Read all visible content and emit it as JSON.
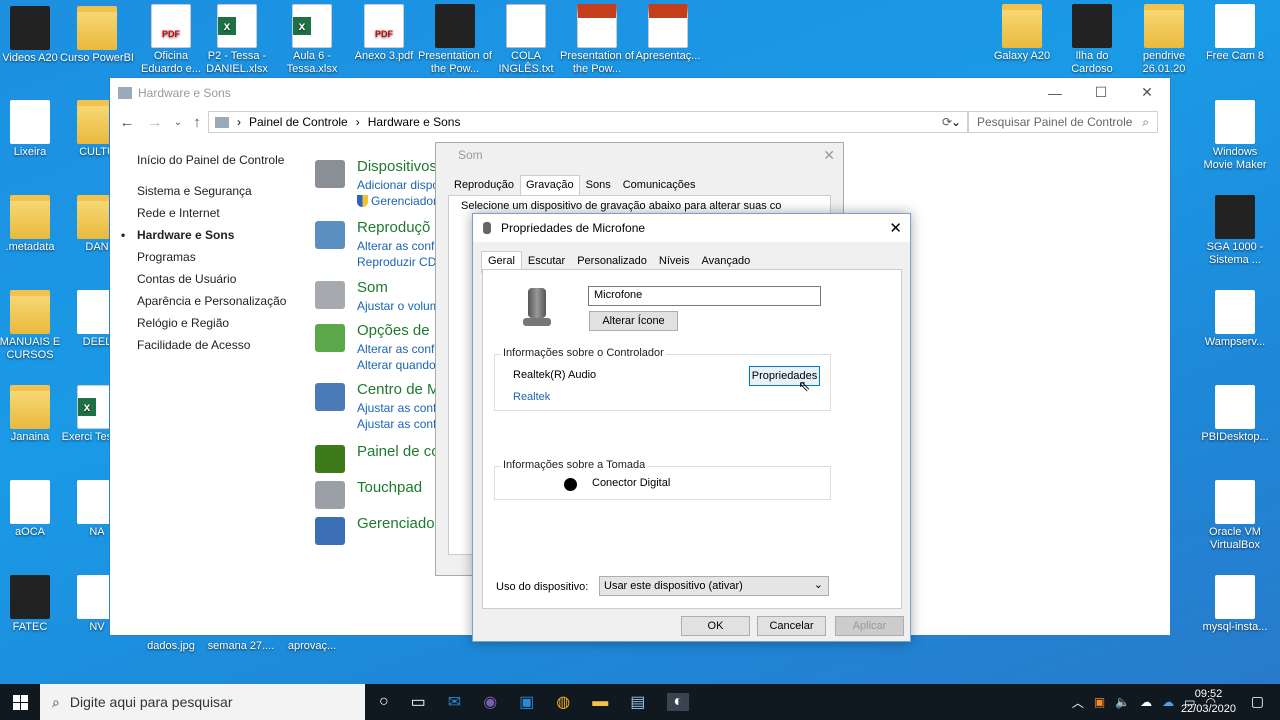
{
  "desktop_left": [
    {
      "label": "Videos A20",
      "kind": "dark"
    },
    {
      "label": "Lixeira",
      "kind": "app"
    },
    {
      "label": ".metadata",
      "kind": "folder"
    },
    {
      "label": "MANUAIS E CURSOS",
      "kind": "folder"
    },
    {
      "label": "Janaina",
      "kind": "folder"
    },
    {
      "label": "aOCA",
      "kind": "app"
    },
    {
      "label": "FATEC",
      "kind": "dark"
    }
  ],
  "desktop_col2": [
    {
      "label": "Curso PowerBI",
      "kind": "folder"
    },
    {
      "label": "CULTU",
      "kind": "folder"
    },
    {
      "label": "DAN",
      "kind": "folder"
    },
    {
      "label": "DEEL",
      "kind": "app"
    },
    {
      "label": "Exerci Tessa.x",
      "kind": "xls"
    },
    {
      "label": "NA",
      "kind": "app"
    },
    {
      "label": "NV",
      "kind": "app"
    }
  ],
  "desktop_top": [
    {
      "label": "Oficina Eduardo e...",
      "kind": "pdf"
    },
    {
      "label": "P2 - Tessa - DANIEL.xlsx",
      "kind": "xls"
    },
    {
      "label": "Aula 6 - Tessa.xlsx",
      "kind": "xls"
    },
    {
      "label": "Anexo 3.pdf",
      "kind": "pdf"
    },
    {
      "label": "Presentation of the Pow...",
      "kind": "dark"
    },
    {
      "label": "COLA INGLÊS.txt",
      "kind": "txt"
    },
    {
      "label": "Presentation of the Pow...",
      "kind": "ppt"
    },
    {
      "label": "Apresentaç...",
      "kind": "ppt"
    }
  ],
  "desktop_right_top": [
    {
      "label": "Galaxy A20",
      "kind": "folder"
    },
    {
      "label": "Ilha do Cardoso",
      "kind": "dark"
    },
    {
      "label": "pendrive 26.01.20",
      "kind": "folder"
    },
    {
      "label": "Free Cam 8",
      "kind": "app"
    }
  ],
  "desktop_right": [
    {
      "label": "Windows Movie Maker",
      "kind": "app"
    },
    {
      "label": "SGA 1000 - Sistema ...",
      "kind": "dark"
    },
    {
      "label": "Wampserv...",
      "kind": "app"
    },
    {
      "label": "PBIDesktop...",
      "kind": "app"
    },
    {
      "label": "Oracle VM VirtualBox",
      "kind": "app"
    },
    {
      "label": "mysql-insta...",
      "kind": "app"
    }
  ],
  "desktop_bottom": [
    {
      "label": "dados.jpg"
    },
    {
      "label": "semana 27...."
    },
    {
      "label": "aprovaç..."
    }
  ],
  "control_panel": {
    "title": "Hardware e Sons",
    "breadcrumb": [
      "Painel de Controle",
      "Hardware e Sons"
    ],
    "search_placeholder": "Pesquisar Painel de Controle",
    "sidebar": [
      "Início do Painel de Controle",
      "Sistema e Segurança",
      "Rede e Internet",
      "Hardware e Sons",
      "Programas",
      "Contas de Usuário",
      "Aparência e Personalização",
      "Relógio e Região",
      "Facilidade de Acesso"
    ],
    "categories": [
      {
        "title": "Dispositivos",
        "links": [
          "Adicionar dispo",
          "Gerenciador"
        ]
      },
      {
        "title": "Reproduçõ",
        "links": [
          "Alterar as config",
          "Reproduzir CDs"
        ]
      },
      {
        "title": "Som",
        "links": [
          "Ajustar o volum"
        ]
      },
      {
        "title": "Opções de E",
        "links": [
          "Alterar as config",
          "Alterar quando o"
        ]
      },
      {
        "title": "Centro de M",
        "links": [
          "Ajustar as config",
          "Ajustar as config"
        ]
      },
      {
        "title": "Painel de co",
        "links": []
      },
      {
        "title": "Touchpad",
        "links": []
      },
      {
        "title": "Gerenciador",
        "links": []
      }
    ]
  },
  "som_dialog": {
    "title": "Som",
    "tabs": [
      "Reprodução",
      "Gravação",
      "Sons",
      "Comunicações"
    ],
    "selected_tab": "Gravação",
    "instruction": "Selecione um dispositivo de gravação abaixo para alterar suas co"
  },
  "mic_dialog": {
    "title": "Propriedades de Microfone",
    "tabs": [
      "Geral",
      "Escutar",
      "Personalizado",
      "Níveis",
      "Avançado"
    ],
    "selected_tab": "Geral",
    "name_value": "Microfone",
    "change_icon_label": "Alterar Ícone",
    "controller_group": "Informações sobre o Controlador",
    "controller_name": "Realtek(R) Audio",
    "controller_vendor": "Realtek",
    "properties_label": "Propriedades",
    "jack_group": "Informações sobre a Tomada",
    "jack_name": "Conector Digital",
    "usage_label": "Uso do dispositivo:",
    "usage_value": "Usar este dispositivo (ativar)",
    "ok_label": "OK",
    "cancel_label": "Cancelar",
    "apply_label": "Aplicar"
  },
  "taskbar": {
    "search_placeholder": "Digite aqui para pesquisar",
    "time": "09:52",
    "date": "22/03/2020"
  },
  "colors": {
    "accent": "#0078d7",
    "link": "#1a64b0",
    "category": "#1e7a2e"
  }
}
